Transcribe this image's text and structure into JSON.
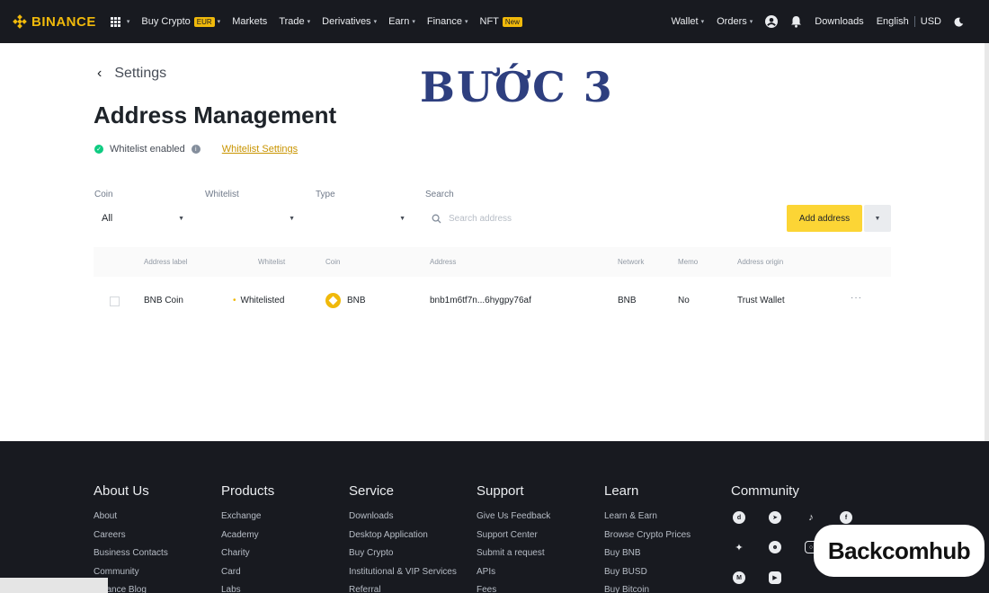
{
  "nav": {
    "brand": "BINANCE",
    "items": [
      {
        "label": "Buy Crypto",
        "badge": "EUR",
        "dropdown": true
      },
      {
        "label": "Markets",
        "badge": "",
        "dropdown": false
      },
      {
        "label": "Trade",
        "badge": "",
        "dropdown": true
      },
      {
        "label": "Derivatives",
        "badge": "",
        "dropdown": true
      },
      {
        "label": "Earn",
        "badge": "",
        "dropdown": true
      },
      {
        "label": "Finance",
        "badge": "",
        "dropdown": true
      },
      {
        "label": "NFT",
        "badge": "New",
        "dropdown": false
      }
    ],
    "right": {
      "wallet": "Wallet",
      "orders": "Orders",
      "downloads": "Downloads",
      "language": "English",
      "currency": "USD"
    }
  },
  "breadcrumb": {
    "back_label": "Settings"
  },
  "step_overlay": "BƯỚC 3",
  "page_title": "Address Management",
  "whitelist": {
    "status": "Whitelist enabled",
    "settings_link": "Whitelist Settings"
  },
  "filters": {
    "coin_label": "Coin",
    "coin_value": "All",
    "whitelist_label": "Whitelist",
    "whitelist_value": "",
    "type_label": "Type",
    "type_value": "",
    "search_label": "Search",
    "search_placeholder": "Search address"
  },
  "actions": {
    "add_address": "Add address"
  },
  "table": {
    "headers": [
      "Address label",
      "Whitelist",
      "Coin",
      "Address",
      "Network",
      "Memo",
      "Address origin"
    ],
    "rows": [
      {
        "label": "BNB Coin",
        "whitelist": "Whitelisted",
        "coin": "BNB",
        "address": "bnb1m6tf7n...6hygpy76af",
        "network": "BNB",
        "memo": "No",
        "origin": "Trust Wallet"
      }
    ]
  },
  "footer": {
    "columns": [
      {
        "title": "About Us",
        "links": [
          "About",
          "Careers",
          "Business Contacts",
          "Community",
          "Binance Blog"
        ]
      },
      {
        "title": "Products",
        "links": [
          "Exchange",
          "Academy",
          "Charity",
          "Card",
          "Labs"
        ]
      },
      {
        "title": "Service",
        "links": [
          "Downloads",
          "Desktop Application",
          "Buy Crypto",
          "Institutional & VIP Services",
          "Referral"
        ]
      },
      {
        "title": "Support",
        "links": [
          "Give Us Feedback",
          "Support Center",
          "Submit a request",
          "APIs",
          "Fees"
        ]
      },
      {
        "title": "Learn",
        "links": [
          "Learn & Earn",
          "Browse Crypto Prices",
          "Buy BNB",
          "Buy BUSD",
          "Buy Bitcoin"
        ]
      }
    ],
    "community_title": "Community",
    "community_icons": [
      "discord-icon",
      "telegram-icon",
      "tiktok-icon",
      "facebook-icon",
      "twitter-icon",
      "reddit-icon",
      "instagram-icon",
      "coinmarketcap-icon",
      "youtube-icon"
    ]
  },
  "watermark": "Backcomhub",
  "colors": {
    "brand": "#f0b90b",
    "nav_bg": "#181a20",
    "accent_button": "#fcd535",
    "step_text": "#2e3f7f",
    "success": "#0ecb81"
  }
}
